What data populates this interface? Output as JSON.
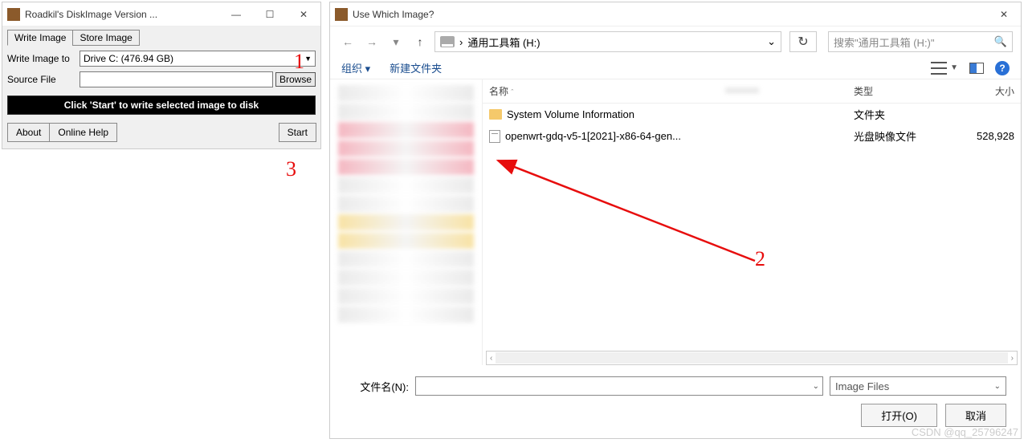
{
  "win1": {
    "title": "Roadkil's DiskImage Version ...",
    "tabs": {
      "write": "Write Image",
      "store": "Store Image"
    },
    "labels": {
      "writeTo": "Write Image to",
      "sourceFile": "Source File"
    },
    "driveSelected": "Drive C: (476.94 GB)",
    "browse": "Browse",
    "status": "Click 'Start' to write selected image to disk",
    "buttons": {
      "about": "About",
      "help": "Online Help",
      "start": "Start"
    }
  },
  "win2": {
    "title": "Use Which Image?",
    "breadcrumb": "通用工具箱 (H:)",
    "searchPlaceholder": "搜索\"通用工具箱 (H:)\"",
    "toolbar": {
      "org": "组织",
      "newFolder": "新建文件夹"
    },
    "columns": {
      "name": "名称",
      "type": "类型",
      "size": "大小"
    },
    "files": [
      {
        "name": "System Volume Information",
        "type": "文件夹",
        "size": "",
        "kind": "folder"
      },
      {
        "name": "openwrt-gdq-v5-1[2021]-x86-64-gen...",
        "type": "光盘映像文件",
        "size": "528,928",
        "kind": "file"
      }
    ],
    "filenameLabel": "文件名(N):",
    "fileTypeFilter": "Image Files",
    "open": "打开(O)",
    "cancel": "取消"
  },
  "anno": {
    "one": "1",
    "two": "2",
    "three": "3"
  },
  "watermark": "CSDN @qq_25796247"
}
